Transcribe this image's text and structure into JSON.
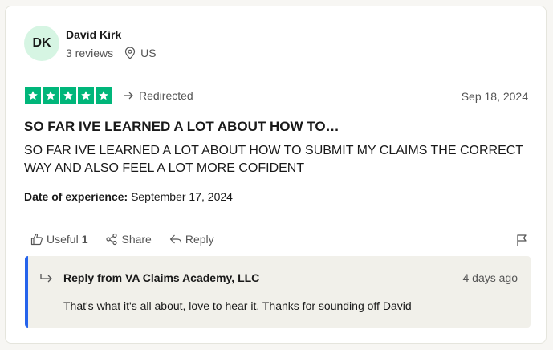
{
  "reviewer": {
    "initials": "DK",
    "name": "David Kirk",
    "reviews": "3 reviews",
    "country": "US"
  },
  "review": {
    "rating": 5,
    "redirected_label": "Redirected",
    "date": "Sep 18, 2024",
    "title": "SO FAR IVE LEARNED A LOT ABOUT HOW TO…",
    "body": "SO FAR IVE LEARNED A LOT ABOUT HOW TO SUBMIT MY CLAIMS THE CORRECT WAY AND ALSO FEEL A LOT MORE COFIDENT",
    "experience_label": "Date of experience:",
    "experience_date": "September 17, 2024"
  },
  "actions": {
    "useful_label": "Useful",
    "useful_count": "1",
    "share_label": "Share",
    "reply_label": "Reply"
  },
  "reply": {
    "from": "Reply from VA Claims Academy, LLC",
    "date": "4 days ago",
    "text": "That's what it's all about, love to hear it. Thanks for sounding off David"
  },
  "colors": {
    "star_green": "#00b67a",
    "avatar_bg": "#d6f5e3",
    "reply_accent": "#2563eb",
    "reply_bg": "#f1f0ea"
  },
  "icons": [
    "star-icon",
    "location-pin-icon",
    "redirect-arrow-icon",
    "thumbs-up-icon",
    "share-icon",
    "reply-icon",
    "flag-icon",
    "reply-arrow-icon"
  ]
}
